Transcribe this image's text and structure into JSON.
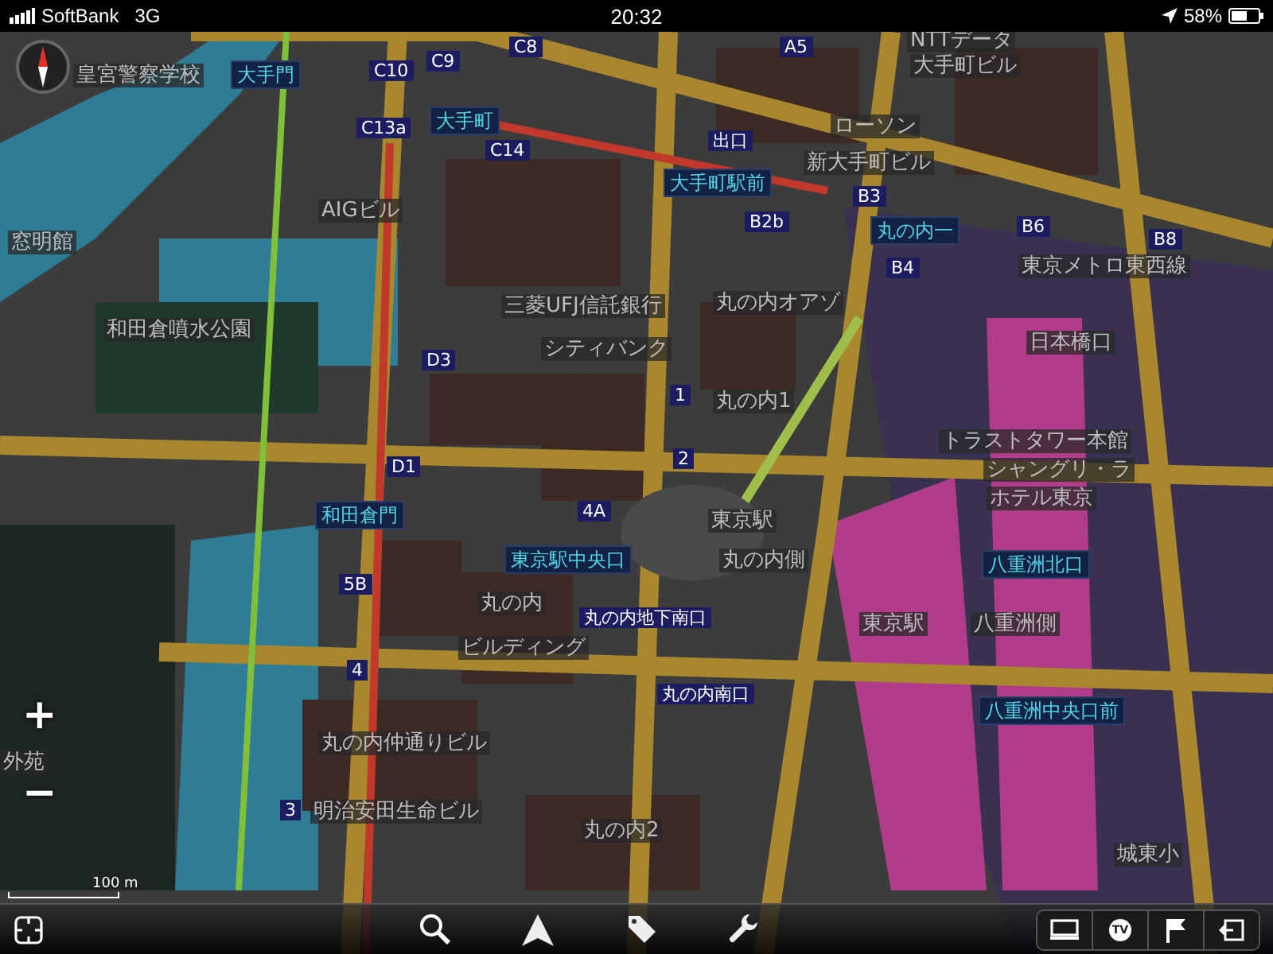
{
  "status_bar": {
    "carrier": "SoftBank",
    "network": "3G",
    "time": "20:32",
    "battery": "58%"
  },
  "map": {
    "scale": "100 m",
    "zoom_in": "+",
    "zoom_out": "−",
    "labels": [
      {
        "text": "大手門",
        "kind": "station"
      },
      {
        "text": "大手町",
        "kind": "station"
      },
      {
        "text": "大手町駅前",
        "kind": "station"
      },
      {
        "text": "丸の内一",
        "kind": "station"
      },
      {
        "text": "和田倉門",
        "kind": "station"
      },
      {
        "text": "東京駅中央口",
        "kind": "station"
      },
      {
        "text": "八重洲北口",
        "kind": "station"
      },
      {
        "text": "八重洲中央口前",
        "kind": "station"
      },
      {
        "text": "丸の内地下南口",
        "kind": "exit"
      },
      {
        "text": "丸の内南口",
        "kind": "exit"
      },
      {
        "text": "C8",
        "kind": "exit"
      },
      {
        "text": "C9",
        "kind": "exit"
      },
      {
        "text": "C10",
        "kind": "exit"
      },
      {
        "text": "C13a",
        "kind": "exit"
      },
      {
        "text": "C14",
        "kind": "exit"
      },
      {
        "text": "出口",
        "kind": "exit"
      },
      {
        "text": "A5",
        "kind": "exit"
      },
      {
        "text": "B2b",
        "kind": "exit"
      },
      {
        "text": "B3",
        "kind": "exit"
      },
      {
        "text": "B4",
        "kind": "exit"
      },
      {
        "text": "B6",
        "kind": "exit"
      },
      {
        "text": "B8",
        "kind": "exit"
      },
      {
        "text": "D3",
        "kind": "exit"
      },
      {
        "text": "D1",
        "kind": "exit"
      },
      {
        "text": "1",
        "kind": "exit"
      },
      {
        "text": "2",
        "kind": "exit"
      },
      {
        "text": "4A",
        "kind": "exit"
      },
      {
        "text": "5B",
        "kind": "exit"
      },
      {
        "text": "4",
        "kind": "exit"
      },
      {
        "text": "3",
        "kind": "exit"
      },
      {
        "text": "皇宮警察学校",
        "kind": "place"
      },
      {
        "text": "AIGビル",
        "kind": "place"
      },
      {
        "text": "窓明館",
        "kind": "place"
      },
      {
        "text": "和田倉噴水公園",
        "kind": "place"
      },
      {
        "text": "三菱UFJ信託銀行",
        "kind": "place"
      },
      {
        "text": "シティバンク",
        "kind": "place"
      },
      {
        "text": "丸の内オアゾ",
        "kind": "place"
      },
      {
        "text": "丸の内1",
        "kind": "place"
      },
      {
        "text": "東京駅",
        "kind": "place"
      },
      {
        "text": "丸の内側",
        "kind": "place"
      },
      {
        "text": "東京駅",
        "kind": "place"
      },
      {
        "text": "八重洲側",
        "kind": "place"
      },
      {
        "text": "新大手町ビル",
        "kind": "place"
      },
      {
        "text": "NTTデータ",
        "kind": "place"
      },
      {
        "text": "大手町ビル",
        "kind": "place"
      },
      {
        "text": "ローソン",
        "kind": "place"
      },
      {
        "text": "東京メトロ東西線",
        "kind": "place"
      },
      {
        "text": "日本橋口",
        "kind": "place"
      },
      {
        "text": "トラストタワー本館",
        "kind": "place"
      },
      {
        "text": "シャングリ・ラ",
        "kind": "place"
      },
      {
        "text": "ホテル東京",
        "kind": "place"
      },
      {
        "text": "丸の内2",
        "kind": "place"
      },
      {
        "text": "城東小",
        "kind": "place"
      },
      {
        "text": "丸の内仲通りビル",
        "kind": "place"
      },
      {
        "text": "明治安田生命ビル",
        "kind": "place"
      },
      {
        "text": "丸の内",
        "kind": "place"
      },
      {
        "text": "ビルディング",
        "kind": "place"
      },
      {
        "text": "外苑",
        "kind": "place"
      }
    ]
  },
  "toolbar": {
    "tv_label": "TV"
  }
}
